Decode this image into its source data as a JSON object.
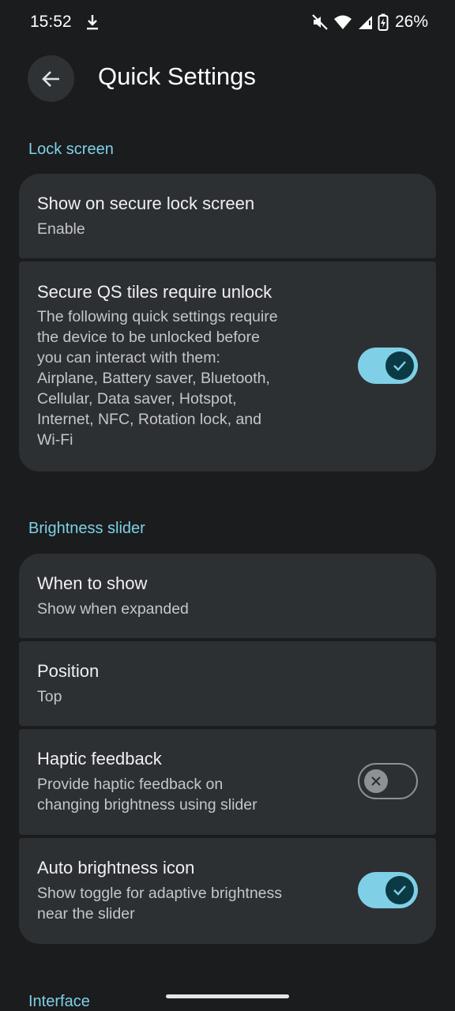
{
  "status_bar": {
    "time": "15:52",
    "battery": "26%",
    "icons": [
      "download-icon",
      "mute-icon",
      "wifi-icon",
      "cellular-signal-icon",
      "battery-charging-icon"
    ]
  },
  "app_bar": {
    "back_icon": "arrow-back-icon",
    "title": "Quick Settings"
  },
  "sections": {
    "lock_screen": {
      "header": "Lock screen",
      "show_on_secure": {
        "title": "Show on secure lock screen",
        "summary": "Enable"
      },
      "secure_tiles": {
        "title": "Secure QS tiles require unlock",
        "summary": "The following quick settings require\nthe device to be unlocked before\nyou can interact with them:\nAirplane, Battery saver, Bluetooth,\nCellular, Data saver, Hotspot,\nInternet, NFC, Rotation lock, and\nWi-Fi",
        "enabled": true
      }
    },
    "brightness_slider": {
      "header": "Brightness slider",
      "when_to_show": {
        "title": "When to show",
        "summary": "Show when expanded"
      },
      "position": {
        "title": "Position",
        "summary": "Top"
      },
      "haptic_feedback": {
        "title": "Haptic feedback",
        "summary": "Provide haptic feedback on\nchanging brightness using slider",
        "enabled": false
      },
      "auto_brightness_icon": {
        "title": "Auto brightness icon",
        "summary": "Show toggle for adaptive brightness\nnear the slider",
        "enabled": true
      }
    },
    "interface": {
      "header": "Interface"
    }
  },
  "colors": {
    "background": "#1a1c1e",
    "card": "#2d3033",
    "accent": "#7fd0e6",
    "toggle_knob_on": "#0b3a45",
    "toggle_off_outline": "#8d9195"
  }
}
